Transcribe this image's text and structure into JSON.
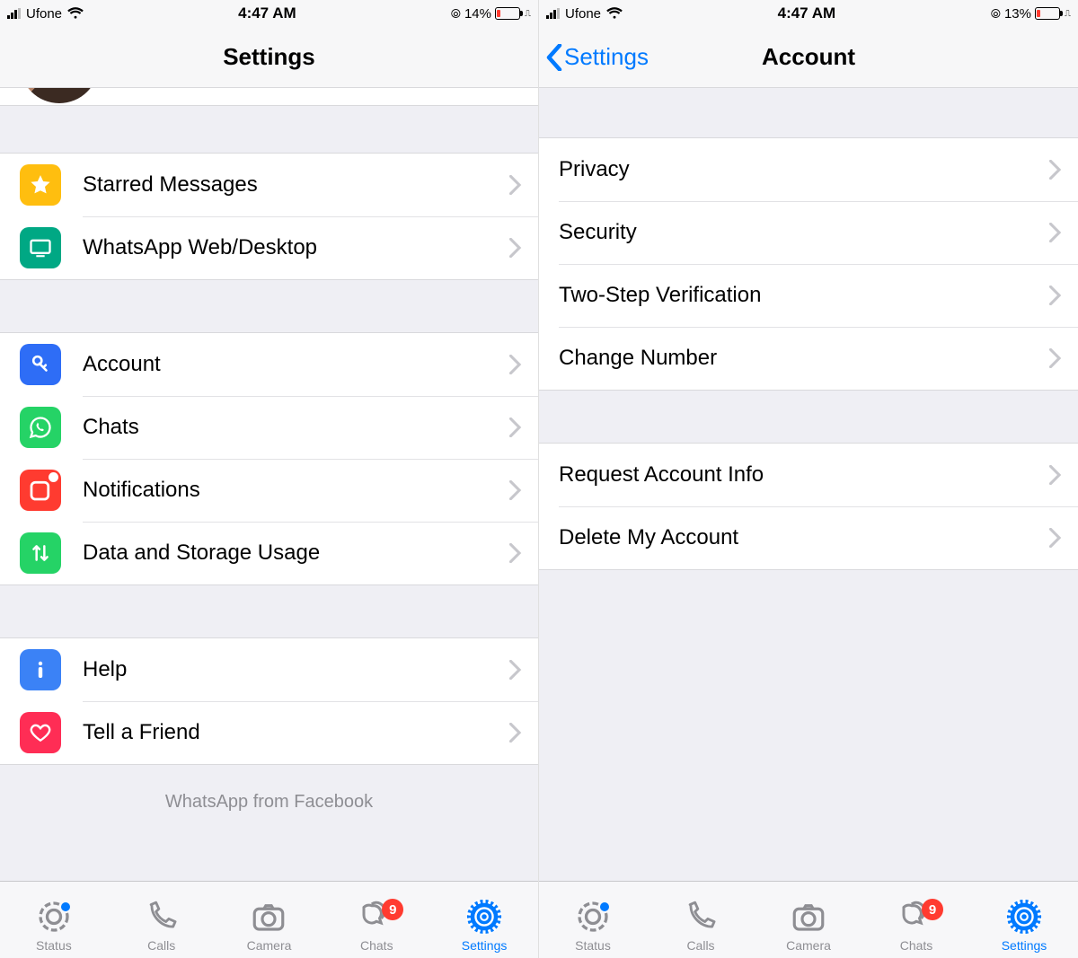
{
  "left": {
    "status": {
      "carrier": "Ufone",
      "time": "4:47 AM",
      "battery": "14%"
    },
    "title": "Settings",
    "group1": [
      {
        "key": "starred",
        "label": "Starred Messages"
      },
      {
        "key": "web",
        "label": "WhatsApp Web/Desktop"
      }
    ],
    "group2": [
      {
        "key": "account",
        "label": "Account"
      },
      {
        "key": "chats",
        "label": "Chats"
      },
      {
        "key": "notifications",
        "label": "Notifications"
      },
      {
        "key": "data",
        "label": "Data and Storage Usage"
      }
    ],
    "group3": [
      {
        "key": "help",
        "label": "Help"
      },
      {
        "key": "tell",
        "label": "Tell a Friend"
      }
    ],
    "footer": "WhatsApp from Facebook"
  },
  "right": {
    "status": {
      "carrier": "Ufone",
      "time": "4:47 AM",
      "battery": "13%"
    },
    "back": "Settings",
    "title": "Account",
    "group1": [
      {
        "key": "privacy",
        "label": "Privacy"
      },
      {
        "key": "security",
        "label": "Security"
      },
      {
        "key": "twostep",
        "label": "Two-Step Verification"
      },
      {
        "key": "change",
        "label": "Change Number"
      }
    ],
    "group2": [
      {
        "key": "request",
        "label": "Request Account Info"
      },
      {
        "key": "delete",
        "label": "Delete My Account"
      }
    ]
  },
  "tabs": [
    {
      "key": "status",
      "label": "Status",
      "dot": true
    },
    {
      "key": "calls",
      "label": "Calls"
    },
    {
      "key": "camera",
      "label": "Camera"
    },
    {
      "key": "chats",
      "label": "Chats",
      "badge": "9"
    },
    {
      "key": "settings",
      "label": "Settings",
      "active": true
    }
  ]
}
